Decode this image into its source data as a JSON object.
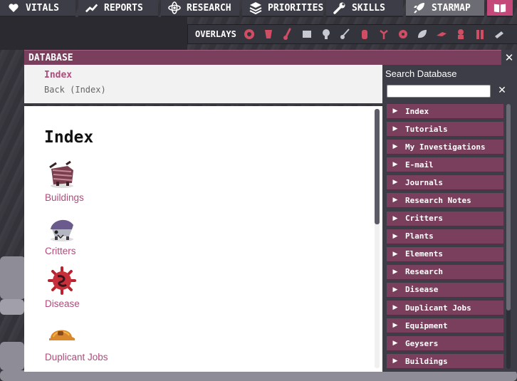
{
  "topbar": {
    "buttons": [
      {
        "label": "VITALS",
        "icon": "heart-icon"
      },
      {
        "label": "REPORTS",
        "icon": "chart-line-icon"
      },
      {
        "label": "RESEARCH",
        "icon": "atom-icon"
      },
      {
        "label": "PRIORITIES",
        "icon": "stack-icon"
      },
      {
        "label": "SKILLS",
        "icon": "wrench-icon"
      },
      {
        "label": "STARMAP",
        "icon": "rocket-icon"
      },
      {
        "label": "",
        "icon": "book-icon"
      }
    ]
  },
  "overlays": {
    "label": "OVERLAYS",
    "icons": [
      "oxygen-overlay-icon",
      "power-overlay-icon",
      "temperature-overlay-icon",
      "materials-overlay-icon",
      "light-overlay-icon",
      "plumbing-overlay-icon",
      "ventilation-overlay-icon",
      "farming-overlay-icon",
      "germs-overlay-icon",
      "decor-overlay-icon",
      "rooms-overlay-icon",
      "exosuit-overlay-icon",
      "automation-overlay-icon",
      "conveyor-overlay-icon"
    ]
  },
  "database": {
    "title": "DATABASE",
    "close": "✕",
    "nav": {
      "current": "Index",
      "back": "Back (Index)"
    },
    "content": {
      "title": "Index",
      "entries": [
        {
          "label": "Buildings",
          "icon": "buildings-icon"
        },
        {
          "label": "Critters",
          "icon": "critter-icon"
        },
        {
          "label": "Disease",
          "icon": "germ-icon"
        },
        {
          "label": "Duplicant Jobs",
          "icon": "hard-hat-icon"
        }
      ]
    },
    "search": {
      "label": "Search Database",
      "value": "",
      "clear": "✕"
    },
    "categories": [
      "Index",
      "Tutorials",
      "My Investigations",
      "E-mail",
      "Journals",
      "Research Notes",
      "Critters",
      "Plants",
      "Elements",
      "Research",
      "Disease",
      "Duplicant Jobs",
      "Equipment",
      "Geysers",
      "Buildings"
    ]
  },
  "colors": {
    "accent": "#7a3f5d",
    "link": "#b04b7c",
    "panel": "#3c3d46"
  }
}
